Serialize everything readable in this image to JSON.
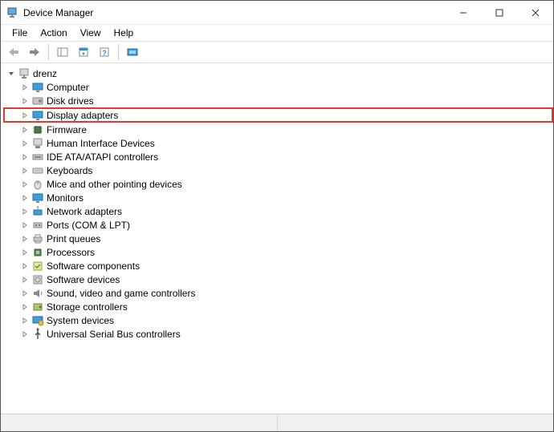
{
  "window": {
    "title": "Device Manager"
  },
  "menu": {
    "items": [
      "File",
      "Action",
      "View",
      "Help"
    ]
  },
  "tree": {
    "root": "drenz",
    "categories": [
      {
        "label": "Computer",
        "icon": "monitor"
      },
      {
        "label": "Disk drives",
        "icon": "disk"
      },
      {
        "label": "Display adapters",
        "icon": "display",
        "highlighted": true
      },
      {
        "label": "Firmware",
        "icon": "chip"
      },
      {
        "label": "Human Interface Devices",
        "icon": "hid"
      },
      {
        "label": "IDE ATA/ATAPI controllers",
        "icon": "ide"
      },
      {
        "label": "Keyboards",
        "icon": "keyboard"
      },
      {
        "label": "Mice and other pointing devices",
        "icon": "mouse"
      },
      {
        "label": "Monitors",
        "icon": "monitor"
      },
      {
        "label": "Network adapters",
        "icon": "network"
      },
      {
        "label": "Ports (COM & LPT)",
        "icon": "port"
      },
      {
        "label": "Print queues",
        "icon": "printer"
      },
      {
        "label": "Processors",
        "icon": "cpu"
      },
      {
        "label": "Software components",
        "icon": "software"
      },
      {
        "label": "Software devices",
        "icon": "softdev"
      },
      {
        "label": "Sound, video and game controllers",
        "icon": "sound"
      },
      {
        "label": "Storage controllers",
        "icon": "storage"
      },
      {
        "label": "System devices",
        "icon": "system"
      },
      {
        "label": "Universal Serial Bus controllers",
        "icon": "usb"
      }
    ]
  }
}
